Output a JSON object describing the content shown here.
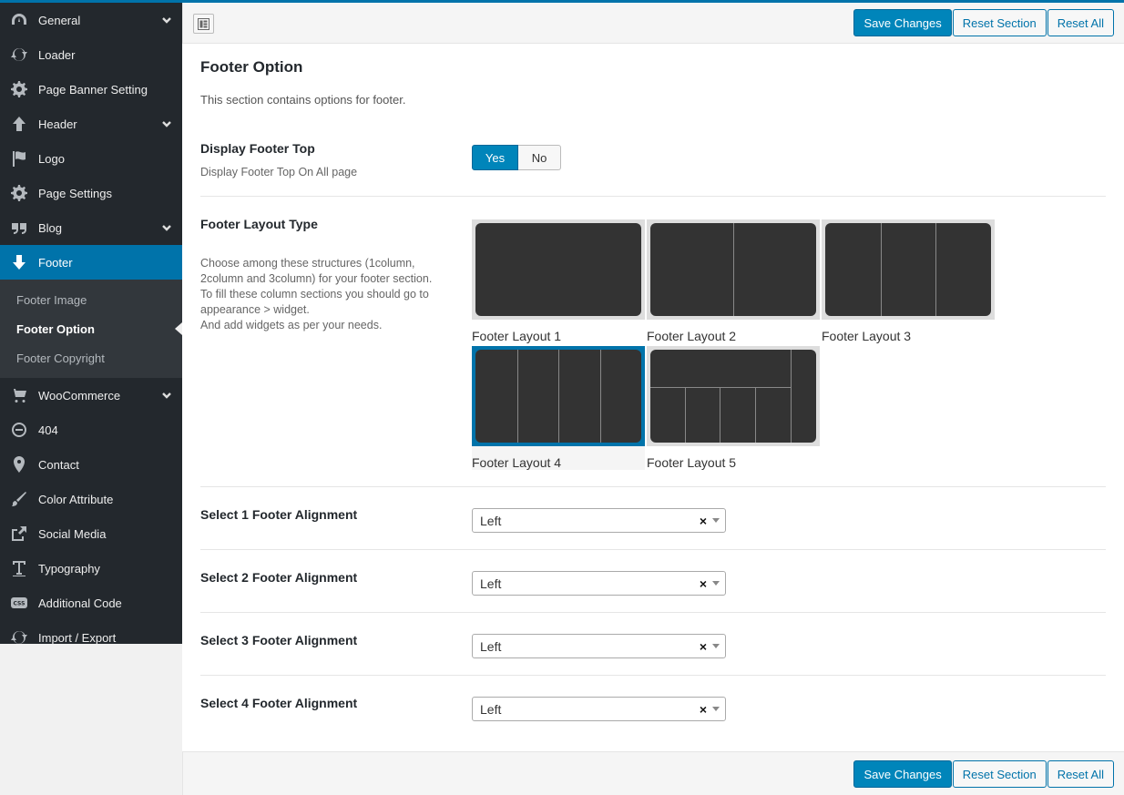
{
  "sidebar": {
    "items": [
      {
        "label": "General",
        "icon": "dashboard-icon",
        "chevron": true
      },
      {
        "label": "Loader",
        "icon": "refresh-icon"
      },
      {
        "label": "Page Banner Setting",
        "icon": "gear-icon"
      },
      {
        "label": "Header",
        "icon": "arrow-up-icon",
        "chevron": true
      },
      {
        "label": "Logo",
        "icon": "flag-icon"
      },
      {
        "label": "Page Settings",
        "icon": "gear-icon"
      },
      {
        "label": "Blog",
        "icon": "quote-icon",
        "chevron": true
      },
      {
        "label": "Footer",
        "icon": "arrow-down-icon",
        "active": true
      },
      {
        "label": "WooCommerce",
        "icon": "cart-icon",
        "chevron": true
      },
      {
        "label": "404",
        "icon": "minus-circle-icon"
      },
      {
        "label": "Contact",
        "icon": "location-pin-icon"
      },
      {
        "label": "Color Attribute",
        "icon": "brush-icon"
      },
      {
        "label": "Social Media",
        "icon": "share-icon"
      },
      {
        "label": "Typography",
        "icon": "text-icon"
      },
      {
        "label": "Additional Code",
        "icon": "css-icon"
      },
      {
        "label": "Import / Export",
        "icon": "refresh-icon"
      }
    ],
    "footer_sub": [
      "Footer Image",
      "Footer Option",
      "Footer Copyright"
    ]
  },
  "toolbar": {
    "save_label": "Save Changes",
    "reset_section_label": "Reset Section",
    "reset_all_label": "Reset All"
  },
  "section": {
    "title": "Footer Option",
    "description": "This section contains options for footer."
  },
  "display_top": {
    "label": "Display Footer Top",
    "sub": "Display Footer Top On All page",
    "yes": "Yes",
    "no": "No",
    "selected": "Yes"
  },
  "layout_type": {
    "label": "Footer Layout Type",
    "desc_1": "Choose among these structures (1column, 2column and 3column) for your footer section.",
    "desc_2": "To fill these column sections you should go to appearance > widget.",
    "desc_3": "And add widgets as per your needs.",
    "options": [
      "Footer Layout 1",
      "Footer Layout 2",
      "Footer Layout 3",
      "Footer Layout 4",
      "Footer Layout 5"
    ],
    "selected": "Footer Layout 4"
  },
  "alignments": [
    {
      "label": "Select 1 Footer Alignment",
      "value": "Left"
    },
    {
      "label": "Select 2 Footer Alignment",
      "value": "Left"
    },
    {
      "label": "Select 3 Footer Alignment",
      "value": "Left"
    },
    {
      "label": "Select 4 Footer Alignment",
      "value": "Left"
    }
  ],
  "colors": {
    "accent": "#0073aa",
    "sidebar_bg": "#23282d",
    "primary_button": "#0085ba"
  }
}
